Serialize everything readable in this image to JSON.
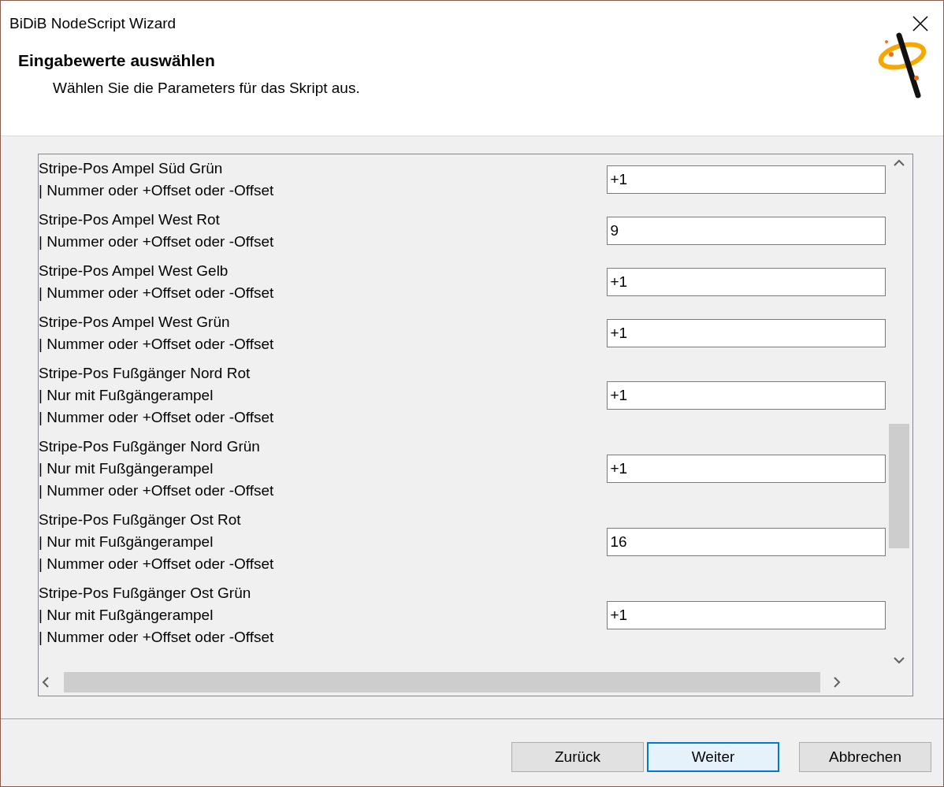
{
  "window": {
    "title": "BiDiB NodeScript Wizard"
  },
  "header": {
    "title": "Eingabewerte auswählen",
    "subtitle": "Wählen Sie die Parameters für das Skript aus."
  },
  "parameters": [
    {
      "lines": [
        "Stripe-Pos Ampel Süd Grün",
        "| Nummer oder +Offset oder -Offset"
      ],
      "value": "+1"
    },
    {
      "lines": [
        "Stripe-Pos Ampel West Rot",
        "| Nummer oder +Offset oder -Offset"
      ],
      "value": "9"
    },
    {
      "lines": [
        "Stripe-Pos Ampel West Gelb",
        "| Nummer oder +Offset oder -Offset"
      ],
      "value": "+1"
    },
    {
      "lines": [
        "Stripe-Pos Ampel West Grün",
        "| Nummer oder +Offset oder -Offset"
      ],
      "value": "+1"
    },
    {
      "lines": [
        "Stripe-Pos Fußgänger Nord Rot",
        "| Nur mit Fußgängerampel",
        "| Nummer oder +Offset oder -Offset"
      ],
      "value": "+1"
    },
    {
      "lines": [
        "Stripe-Pos Fußgänger Nord Grün",
        "| Nur mit Fußgängerampel",
        "| Nummer oder +Offset oder -Offset"
      ],
      "value": "+1"
    },
    {
      "lines": [
        "Stripe-Pos Fußgänger Ost Rot",
        "| Nur mit Fußgängerampel",
        "| Nummer oder +Offset oder -Offset"
      ],
      "value": "16"
    },
    {
      "lines": [
        "Stripe-Pos Fußgänger Ost Grün",
        "| Nur mit Fußgängerampel",
        "| Nummer oder +Offset oder -Offset"
      ],
      "value": "+1"
    }
  ],
  "buttons": [
    {
      "label": "Zurück",
      "default": false
    },
    {
      "label": "Weiter",
      "default": true
    },
    {
      "label": "Abbrechen",
      "default": false
    }
  ]
}
